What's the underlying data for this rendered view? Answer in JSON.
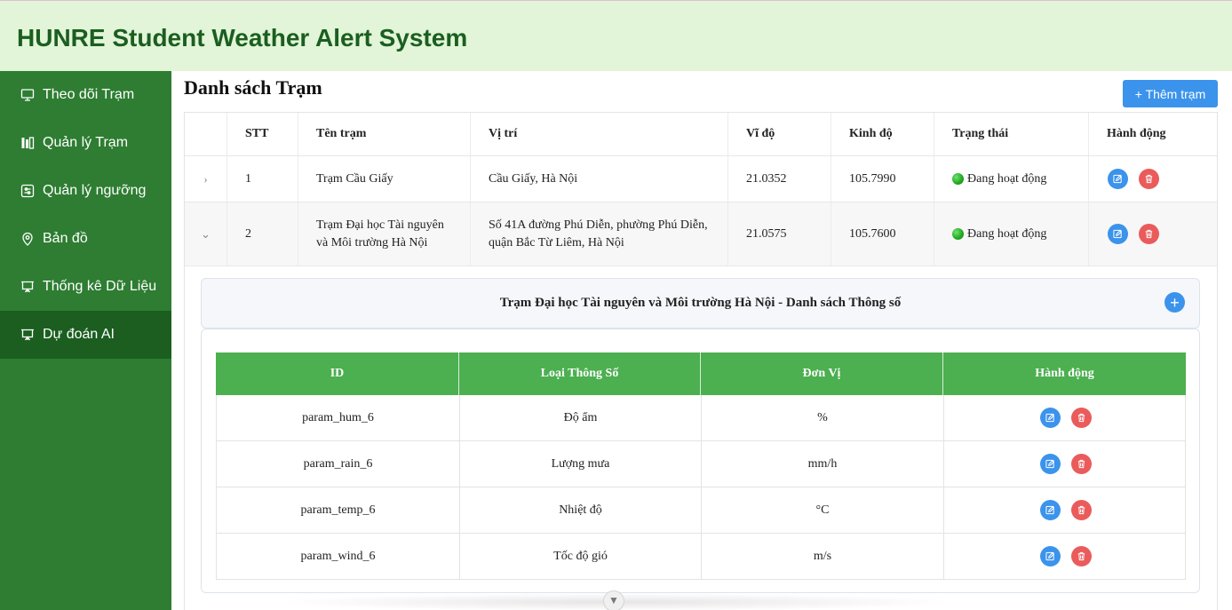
{
  "app": {
    "title": "HUNRE Student Weather Alert System"
  },
  "sidebar": {
    "items": [
      {
        "label": "Theo dõi Trạm",
        "icon": "monitor-icon",
        "active": false
      },
      {
        "label": "Quản lý Trạm",
        "icon": "bar-chart-icon",
        "active": false
      },
      {
        "label": "Quản lý ngưỡng",
        "icon": "sliders-icon",
        "active": false
      },
      {
        "label": "Bản đồ",
        "icon": "map-pin-icon",
        "active": false
      },
      {
        "label": "Thống kê Dữ Liệu",
        "icon": "presentation-icon",
        "active": false
      },
      {
        "label": "Dự đoán AI",
        "icon": "presentation-icon",
        "active": true
      }
    ]
  },
  "main": {
    "heading": "Danh sách Trạm",
    "add_button": "+ Thêm trạm",
    "columns": [
      "STT",
      "Tên trạm",
      "Vị trí",
      "Vĩ độ",
      "Kinh độ",
      "Trạng thái",
      "Hành động"
    ],
    "rows": [
      {
        "stt": "1",
        "name": "Trạm Cầu Giấy",
        "name_line2": "",
        "location": "Cầu Giấy, Hà Nội",
        "location_line2": "",
        "lat": "21.0352",
        "lng": "105.7990",
        "status": "Đang hoạt động",
        "expanded": false
      },
      {
        "stt": "2",
        "name": "Trạm Đại học Tài nguyên",
        "name_line2": "và Môi trường Hà Nội",
        "location": "Số 41A đường Phú Diễn, phường Phú Diễn,",
        "location_line2": "quận Bắc Từ Liêm, Hà Nội",
        "lat": "21.0575",
        "lng": "105.7600",
        "status": "Đang hoạt động",
        "expanded": true
      }
    ],
    "detail": {
      "title": "Trạm Đại học Tài nguyên và Môi trường Hà Nội - Danh sách Thông số",
      "add_symbol": "+",
      "columns": [
        "ID",
        "Loại Thông Số",
        "Đơn Vị",
        "Hành động"
      ],
      "params": [
        {
          "id": "param_hum_6",
          "type": "Độ ẩm",
          "unit": "%"
        },
        {
          "id": "param_rain_6",
          "type": "Lượng mưa",
          "unit": "mm/h"
        },
        {
          "id": "param_temp_6",
          "type": "Nhiệt độ",
          "unit": "°C"
        },
        {
          "id": "param_wind_6",
          "type": "Tốc độ gió",
          "unit": "m/s"
        }
      ]
    }
  },
  "colors": {
    "header_bg": "#e2f5d8",
    "title_text": "#1b5e20",
    "sidebar_bg": "#2e7d32",
    "sidebar_active": "#1b5e20",
    "primary": "#3b93ec",
    "danger": "#ea5b5b",
    "param_header": "#4caf50",
    "status_active": "#1fa61f"
  }
}
